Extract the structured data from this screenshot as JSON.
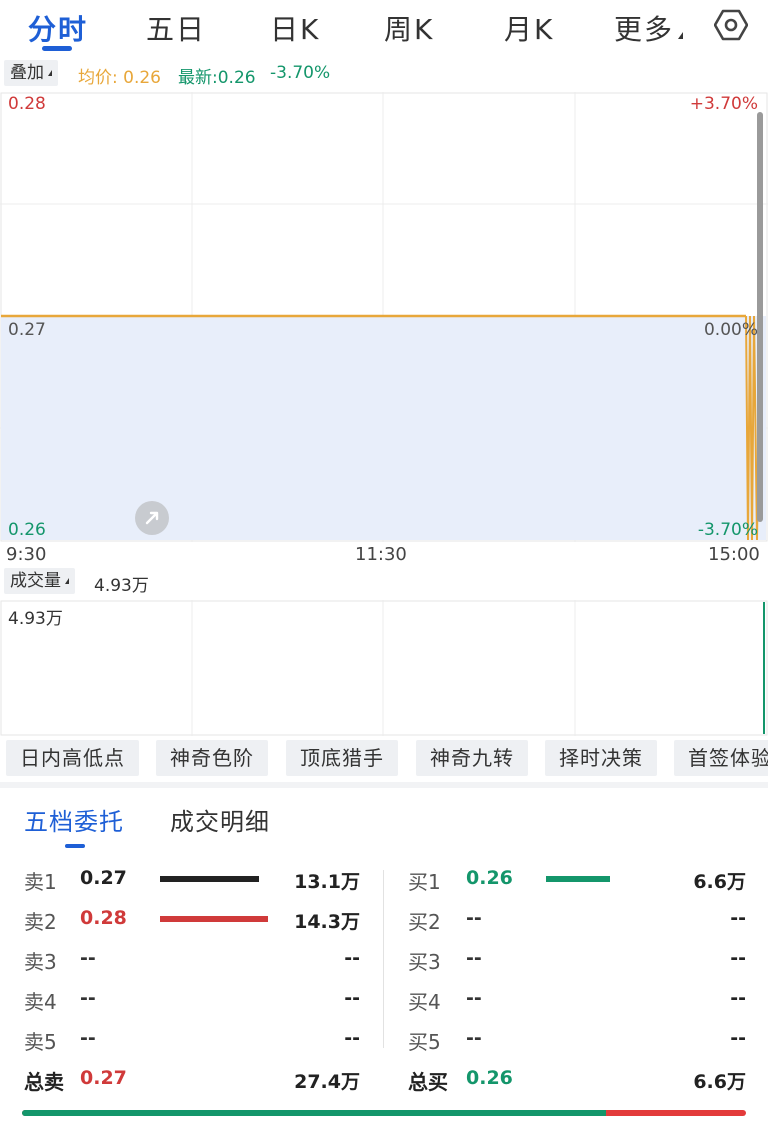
{
  "tabs": [
    "分时",
    "五日",
    "日K",
    "周K",
    "月K",
    "更多"
  ],
  "settings_icon": "gear-icon",
  "overlay": {
    "button_label": "叠加",
    "avg_label": "均价: 0.26",
    "latest_label": "最新:0.26",
    "change_label": "-3.70%"
  },
  "chart": {
    "price_top": "0.28",
    "price_mid": "0.27",
    "price_bottom": "0.26",
    "pct_top": "+3.70%",
    "pct_mid": "0.00%",
    "pct_bottom": "-3.70%",
    "times": [
      "9:30",
      "11:30",
      "15:00"
    ],
    "colors": {
      "avg_line": "#e8a73a",
      "fill": "#e8eefa",
      "up": "#d03a3a",
      "down": "#14966b"
    }
  },
  "chart_data": {
    "type": "line",
    "x": [
      "9:30",
      "11:30",
      "15:00"
    ],
    "ylim": [
      0.26,
      0.28
    ],
    "series": [
      {
        "values": [
          0.27,
          0.27,
          0.26
        ]
      }
    ]
  },
  "volume": {
    "button_label": "成交量",
    "value": "4.93万",
    "axis_max": "4.93万"
  },
  "indicators": [
    "日内高低点",
    "神奇色阶",
    "顶底猎手",
    "神奇九转",
    "择时决策",
    "首签体验"
  ],
  "orderbook": {
    "tabs": [
      "五档委托",
      "成交明细"
    ],
    "sell": [
      {
        "label": "卖1",
        "price": "0.27",
        "volume": "13.1万",
        "color": "#222222",
        "bar_fraction": 0.92
      },
      {
        "label": "卖2",
        "price": "0.28",
        "volume": "14.3万",
        "color": "#d03a3a",
        "bar_fraction": 1.0
      },
      {
        "label": "卖3",
        "price": "--",
        "volume": "--"
      },
      {
        "label": "卖4",
        "price": "--",
        "volume": "--"
      },
      {
        "label": "卖5",
        "price": "--",
        "volume": "--"
      }
    ],
    "buy": [
      {
        "label": "买1",
        "price": "0.26",
        "volume": "6.6万",
        "color": "#14966b",
        "bar_fraction": 0.46
      },
      {
        "label": "买2",
        "price": "--",
        "volume": "--"
      },
      {
        "label": "买3",
        "price": "--",
        "volume": "--"
      },
      {
        "label": "买4",
        "price": "--",
        "volume": "--"
      },
      {
        "label": "买5",
        "price": "--",
        "volume": "--"
      }
    ],
    "total_sell": {
      "label": "总卖",
      "price": "0.27",
      "volume": "27.4万"
    },
    "total_buy": {
      "label": "总买",
      "price": "0.26",
      "volume": "6.6万"
    },
    "sell_ratio": 0.806
  }
}
